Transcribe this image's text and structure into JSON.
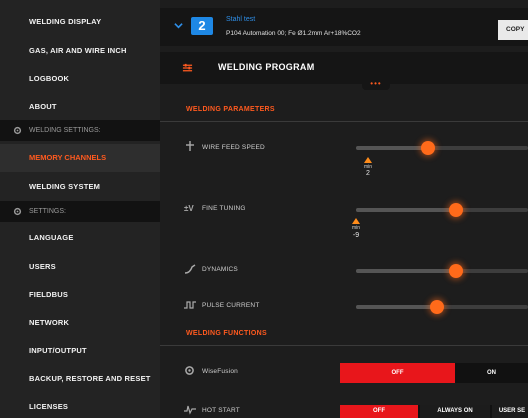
{
  "sidebar": {
    "items": [
      {
        "label": "WELDING DISPLAY"
      },
      {
        "label": "GAS, AIR AND WIRE INCH"
      },
      {
        "label": "LOGBOOK"
      },
      {
        "label": "ABOUT"
      }
    ],
    "section_welding": "WELDING SETTINGS:",
    "active_item": "MEMORY CHANNELS",
    "welding_system": "WELDING SYSTEM",
    "section_settings": "SETTINGS:",
    "settings_items": [
      {
        "label": "LANGUAGE"
      },
      {
        "label": "USERS"
      },
      {
        "label": "FIELDBUS"
      },
      {
        "label": "NETWORK"
      },
      {
        "label": "INPUT/OUTPUT"
      },
      {
        "label": "BACKUP, RESTORE AND RESET"
      },
      {
        "label": "LICENSES"
      }
    ]
  },
  "header": {
    "channel_number": "2",
    "job_name": "Stahl test",
    "job_description": "P104 Automation 00; Fe Ø1.2mm Ar+18%CO2",
    "copy_label": "COPY"
  },
  "program": {
    "title": "WELDING PROGRAM",
    "dots": "•••"
  },
  "parameters": {
    "header": "WELDING PARAMETERS",
    "rows": [
      {
        "label": "WIRE FEED SPEED",
        "level": 0.42,
        "min_label": "min",
        "min_value": "2"
      },
      {
        "label": "FINE TUNING",
        "level": 0.58,
        "min_label": "min",
        "min_value": "-9"
      },
      {
        "label": "DYNAMICS",
        "level": 0.58
      },
      {
        "label": "PULSE CURRENT",
        "level": 0.47
      }
    ]
  },
  "functions": {
    "header": "WELDING FUNCTIONS",
    "wisefusion": {
      "label": "WiseFusion",
      "options": [
        "OFF",
        "ON"
      ],
      "selected": "OFF"
    },
    "hotstart": {
      "label": "HOT START",
      "options": [
        "OFF",
        "ALWAYS ON",
        "USER SE"
      ],
      "selected": "OFF"
    }
  },
  "colors": {
    "accent": "#ff5a1f",
    "badge": "#1e88e5",
    "toggle_on": "#e8161b"
  }
}
